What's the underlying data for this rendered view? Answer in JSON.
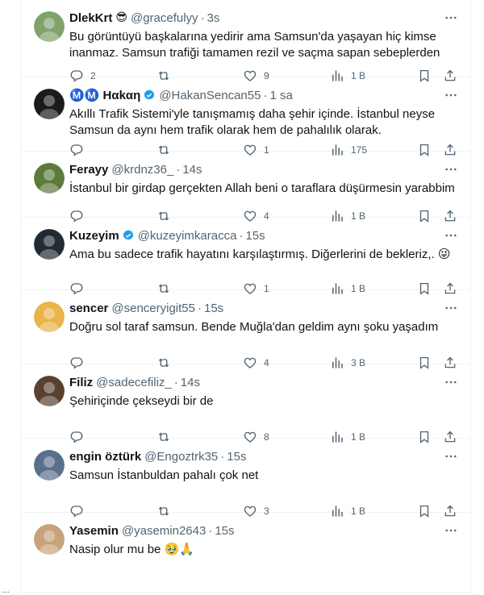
{
  "tweets": [
    {
      "name": "DlekKrt",
      "name_emoji": "😎",
      "verified": false,
      "handle": "@gracefulyy",
      "time": "3s",
      "text": "Bu görüntüyü başkalarına yedirir ama Samsun'da yaşayan hiç kimse inanmaz. Samsun trafiği tamamen rezil ve saçma sapan sebeplerden",
      "replies": "2",
      "retweets": "",
      "likes": "9",
      "views": "1 B",
      "avatar_color": "#7fa36b"
    },
    {
      "name": "Ⓜ️Ⓜ️ Hαkαη",
      "name_emoji": "",
      "verified": true,
      "handle": "@HakanSencan55",
      "time": "1 sa",
      "text": "Akıllı Trafik Sistemi'yle tanışmamış daha şehir içinde. İstanbul neyse Samsun da aynı hem trafik olarak hem de pahalılık olarak.",
      "replies": "",
      "retweets": "",
      "likes": "1",
      "views": "175",
      "avatar_color": "#1b1b1b"
    },
    {
      "name": "Ferayy",
      "name_emoji": "",
      "verified": false,
      "handle": "@krdnz36_",
      "time": "14s",
      "text": "İstanbul bir girdap gerçekten Allah beni o taraflara düşürmesin yarabbim",
      "replies": "",
      "retweets": "",
      "likes": "4",
      "views": "1 B",
      "avatar_color": "#5c7a3a"
    },
    {
      "name": "Kuzeyim",
      "name_emoji": "",
      "verified": true,
      "handle": "@kuzeyimkaracca",
      "time": "15s",
      "text": "Ama bu sadece trafik hayatını karşılaştırmış. Diğerlerini de bekleriz,. 😜",
      "replies": "",
      "retweets": "",
      "likes": "1",
      "views": "1 B",
      "avatar_color": "#222a33"
    },
    {
      "name": "sencer",
      "name_emoji": "",
      "verified": false,
      "handle": "@senceryigit55",
      "time": "15s",
      "text": "Doğru sol taraf samsun. Bende Muğla'dan geldim aynı şoku yaşadım",
      "replies": "",
      "retweets": "",
      "likes": "4",
      "views": "3 B",
      "avatar_color": "#e9b44a"
    },
    {
      "name": "Filiz",
      "name_emoji": "",
      "verified": false,
      "handle": "@sadecefiliz_",
      "time": "14s",
      "text": "Şehiriçinde çekseydi bir de",
      "replies": "",
      "retweets": "",
      "likes": "8",
      "views": "1 B",
      "avatar_color": "#5a4030"
    },
    {
      "name": "engin öztürk",
      "name_emoji": "",
      "verified": false,
      "handle": "@Engoztrk35",
      "time": "15s",
      "text": "Samsun İstanbuldan pahalı çok net",
      "replies": "",
      "retweets": "",
      "likes": "3",
      "views": "1 B",
      "avatar_color": "#5a6f8a"
    },
    {
      "name": "Yasemin",
      "name_emoji": "",
      "verified": false,
      "handle": "@yasemin2643",
      "time": "15s",
      "text": "Nasip olur mu be 🥹🙏",
      "replies": "",
      "retweets": "",
      "likes": "",
      "views": "",
      "avatar_color": "#c7a27c"
    }
  ],
  "colors": {
    "text": "#0f1419",
    "muted": "#536471",
    "verified": "#1d9bf0",
    "border": "#eff3f4"
  },
  "icons": [
    "reply-icon",
    "retweet-icon",
    "like-icon",
    "views-icon",
    "bookmark-icon",
    "share-icon",
    "more-icon",
    "verified-icon"
  ],
  "edge_mark": "…"
}
